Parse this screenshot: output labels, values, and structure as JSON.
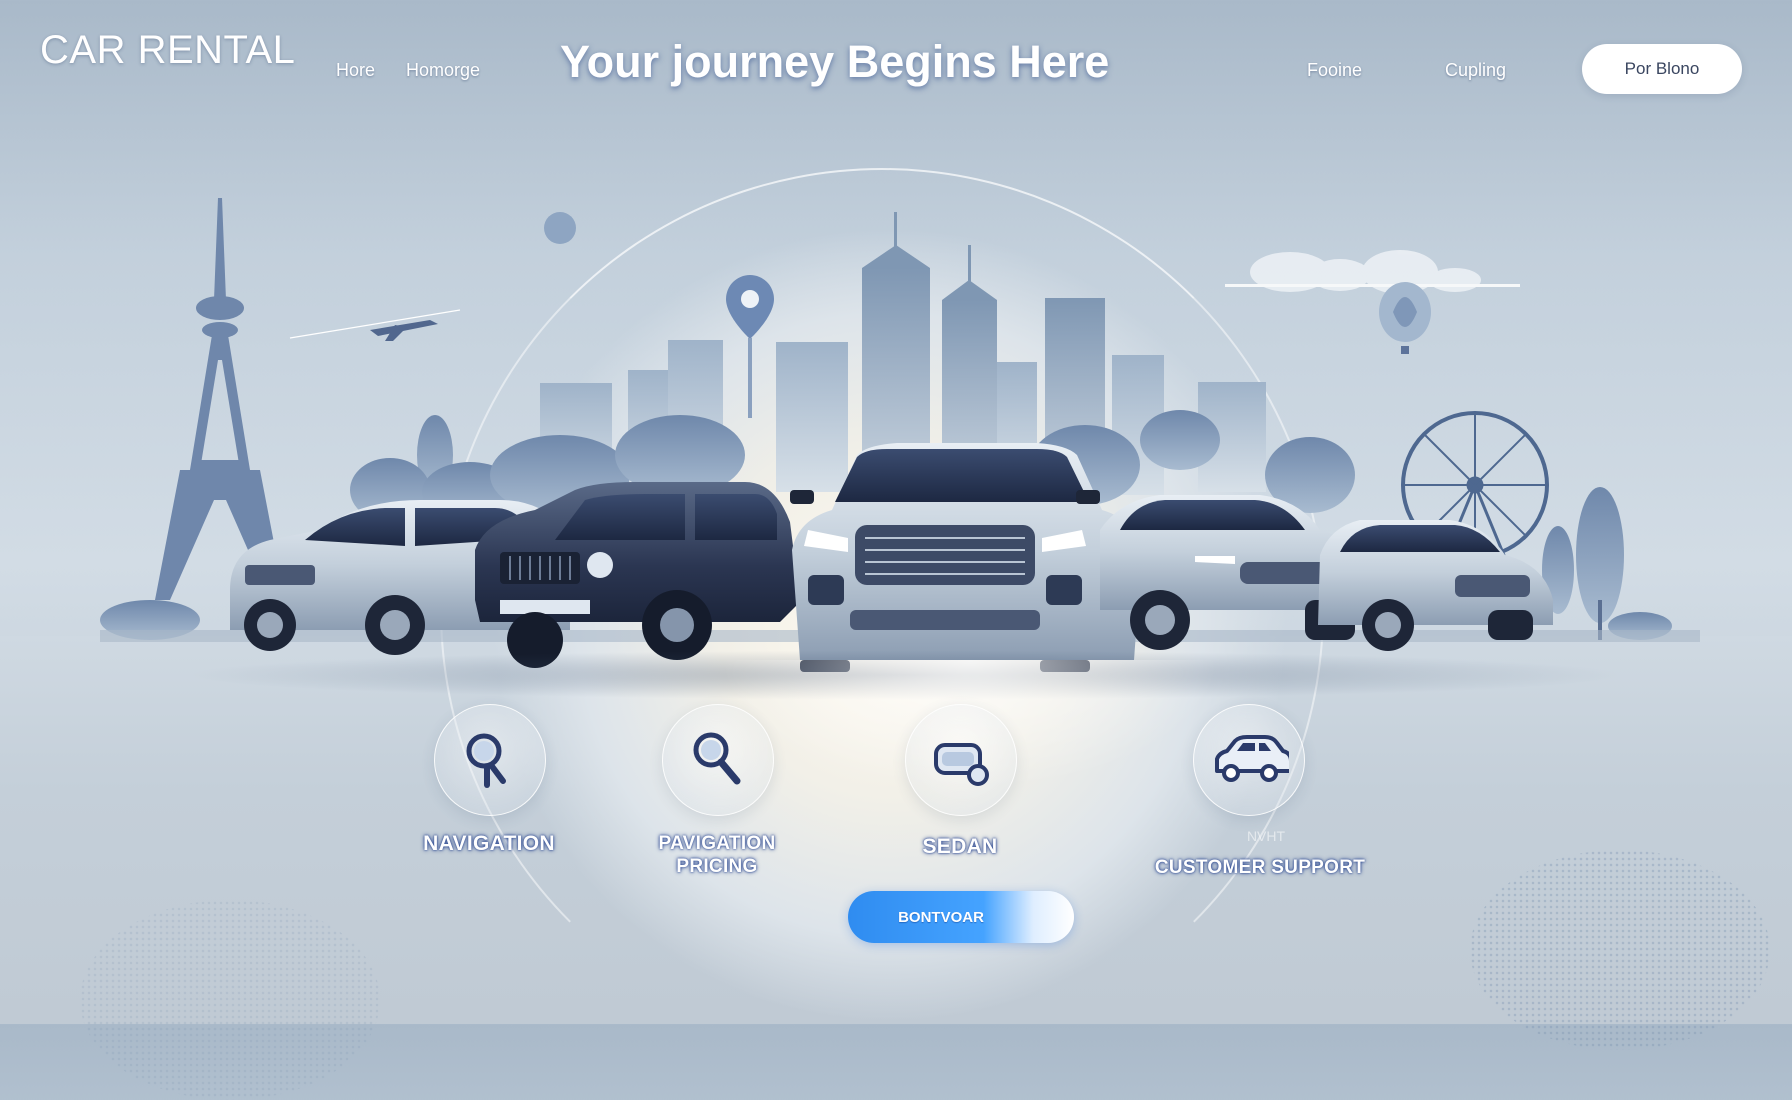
{
  "header": {
    "logo": "CAR RENTAL",
    "nav_left": [
      "Hore",
      "Homorge"
    ],
    "hero_title": "Your journey Begins Here",
    "nav_right": [
      "Fooine",
      "Cupling"
    ],
    "cta_label": "Por Blono"
  },
  "features": [
    {
      "label": "NAVIGATION",
      "icon": "search-icon"
    },
    {
      "label_line1": "PAVIGATION",
      "label_line2": "PRICING",
      "icon": "search-icon"
    },
    {
      "label": "SEDAN",
      "icon": "mirror-icon"
    },
    {
      "label_faint": "NVHT",
      "label": "CUSTOMER SUPPORT",
      "icon": "car-icon"
    }
  ],
  "bottom_cta": {
    "label": "BONTVOAR"
  },
  "colors": {
    "background": "#c3d0dc",
    "accent_blue": "#2f8cf0",
    "title_glow": "#1e3c82",
    "icon_navy": "#2a3a6a",
    "car_silver": "#c9d3de",
    "car_dark": "#2a3550"
  }
}
